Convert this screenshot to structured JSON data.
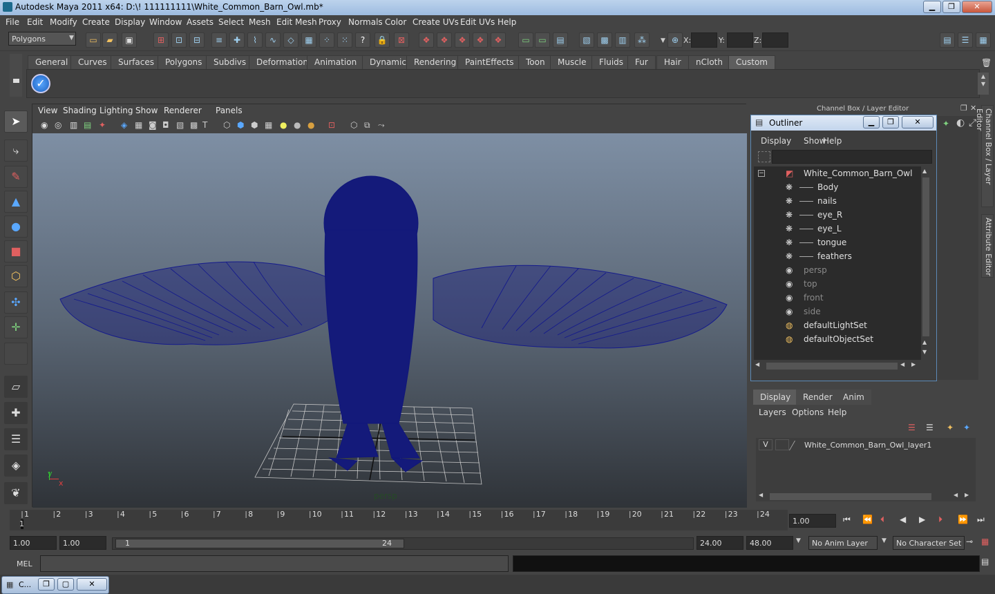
{
  "window": {
    "title": "Autodesk Maya 2011 x64: D:\\! 111111111\\White_Common_Barn_Owl.mb*",
    "min": "▁",
    "max": "❐",
    "close": "✕"
  },
  "menubar": [
    "File",
    "Edit",
    "Modify",
    "Create",
    "Display",
    "Window",
    "Assets",
    "Select",
    "Mesh",
    "Edit Mesh",
    "Proxy",
    "Normals",
    "Color",
    "Create UVs",
    "Edit UVs",
    "Help"
  ],
  "status": {
    "mode": "Polygons",
    "x_label": "X:",
    "y_label": "Y:",
    "z_label": "Z:"
  },
  "shelf_tabs": [
    "General",
    "Curves",
    "Surfaces",
    "Polygons",
    "Subdivs",
    "Deformation",
    "Animation",
    "Dynamics",
    "Rendering",
    "PaintEffects",
    "Toon",
    "Muscle",
    "Fluids",
    "Fur",
    "Hair",
    "nCloth",
    "Custom"
  ],
  "shelf_active": "Custom",
  "viewport": {
    "menus": [
      "View",
      "Shading",
      "Lighting",
      "Show",
      "Renderer",
      "Panels"
    ],
    "camera_label": "persp",
    "axis_y": "y",
    "axis_x": "x"
  },
  "channel_box_title": "Channel Box / Layer Editor",
  "side_tabs": [
    "Channel Box / Layer Editor",
    "Attribute Editor"
  ],
  "outliner": {
    "title": "Outliner",
    "menus": [
      "Display",
      "Show",
      "Help"
    ],
    "items": [
      {
        "label": "White_Common_Barn_Owl",
        "indent": 0,
        "dim": false,
        "icon": "group-icon"
      },
      {
        "label": "Body",
        "indent": 1,
        "dim": false,
        "icon": "mesh-icon"
      },
      {
        "label": "nails",
        "indent": 1,
        "dim": false,
        "icon": "mesh-icon"
      },
      {
        "label": "eye_R",
        "indent": 1,
        "dim": false,
        "icon": "mesh-icon"
      },
      {
        "label": "eye_L",
        "indent": 1,
        "dim": false,
        "icon": "mesh-icon"
      },
      {
        "label": "tongue",
        "indent": 1,
        "dim": false,
        "icon": "mesh-icon"
      },
      {
        "label": "feathers",
        "indent": 1,
        "dim": false,
        "icon": "mesh-icon"
      },
      {
        "label": "persp",
        "indent": 0,
        "dim": true,
        "icon": "camera-icon"
      },
      {
        "label": "top",
        "indent": 0,
        "dim": true,
        "icon": "camera-icon"
      },
      {
        "label": "front",
        "indent": 0,
        "dim": true,
        "icon": "camera-icon"
      },
      {
        "label": "side",
        "indent": 0,
        "dim": true,
        "icon": "camera-icon"
      },
      {
        "label": "defaultLightSet",
        "indent": 0,
        "dim": false,
        "icon": "set-icon"
      },
      {
        "label": "defaultObjectSet",
        "indent": 0,
        "dim": false,
        "icon": "set-icon"
      }
    ]
  },
  "layers": {
    "tabs": [
      "Display",
      "Render",
      "Anim"
    ],
    "menus": [
      "Layers",
      "Options",
      "Help"
    ],
    "visibility": "V",
    "layer_name": "White_Common_Barn_Owl_layer1"
  },
  "timeline": {
    "ticks": [
      "1",
      "2",
      "3",
      "4",
      "5",
      "6",
      "7",
      "8",
      "9",
      "10",
      "11",
      "12",
      "13",
      "14",
      "15",
      "16",
      "17",
      "18",
      "19",
      "20",
      "21",
      "22",
      "23",
      "24"
    ],
    "current": "1",
    "current_time": "1.00"
  },
  "range": {
    "start": "1.00",
    "playback_start": "1.00",
    "slider_left": "1",
    "slider_right": "24",
    "playback_end": "24.00",
    "end": "48.00",
    "anim_layer": "No Anim Layer",
    "char_set": "No Character Set"
  },
  "cmd": {
    "label": "MEL"
  },
  "taskbar": {
    "item": "C..."
  }
}
